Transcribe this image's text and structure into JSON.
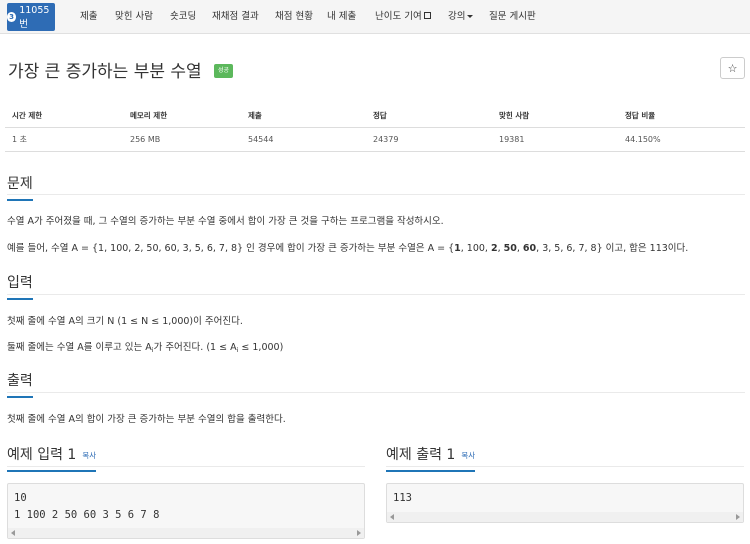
{
  "nav": {
    "problem_number": "11055번",
    "tier_icon_label": "3",
    "items": [
      {
        "label": "제출"
      },
      {
        "label": "맞힌 사람"
      },
      {
        "label": "숏코딩"
      },
      {
        "label": "재채점 결과"
      },
      {
        "label": "채점 현황"
      },
      {
        "label": "내 제출"
      },
      {
        "label": "난이도 기여"
      },
      {
        "label": "강의"
      },
      {
        "label": "질문 게시판"
      }
    ]
  },
  "problem": {
    "title": "가장 큰 증가하는 부분 수열",
    "status": "성공",
    "favorite_icon": "☆"
  },
  "stats": {
    "headers": [
      "시간 제한",
      "메모리 제한",
      "제출",
      "정답",
      "맞힌 사람",
      "정답 비율"
    ],
    "values": [
      "1 초",
      "256 MB",
      "54544",
      "24379",
      "19381",
      "44.150%"
    ]
  },
  "sections": {
    "problem_heading": "문제",
    "problem_text_1": "수열 A가 주어졌을 때, 그 수열의 증가하는 부분 수열 중에서 합이 가장 큰 것을 구하는 프로그램을 작성하시오.",
    "problem_text_2_prefix": "예를 들어, 수열 A = {1, 100, 2, 50, 60, 3, 5, 6, 7, 8} 인 경우에 합이 가장 큰 증가하는 부분 수열은 A = {",
    "problem_text_2_seq": [
      {
        "t": "1",
        "b": true
      },
      {
        "t": ", 100, ",
        "b": false
      },
      {
        "t": "2",
        "b": true
      },
      {
        "t": ", ",
        "b": false
      },
      {
        "t": "50",
        "b": true
      },
      {
        "t": ", ",
        "b": false
      },
      {
        "t": "60",
        "b": true
      },
      {
        "t": ", 3, 5, 6, 7, 8",
        "b": false
      }
    ],
    "problem_text_2_suffix": "} 이고, 합은 113이다.",
    "input_heading": "입력",
    "input_text_1": "첫째 줄에 수열 A의 크기 N (1 ≤ N ≤ 1,000)이 주어진다.",
    "input_text_2_a": "둘째 줄에는 수열 A를 이루고 있는 A",
    "input_text_2_sub": "i",
    "input_text_2_b": "가 주어진다. (1 ≤ A",
    "input_text_2_sub2": "i",
    "input_text_2_c": " ≤ 1,000)",
    "output_heading": "출력",
    "output_text": "첫째 줄에 수열 A의 합이 가장 큰 증가하는 부분 수열의 합을 출력한다."
  },
  "examples": {
    "input_heading": "예제 입력 1",
    "output_heading": "예제 출력 1",
    "copy_label": "복사",
    "input_content": "10\n1 100 2 50 60 3 5 6 7 8",
    "output_content": "113"
  }
}
